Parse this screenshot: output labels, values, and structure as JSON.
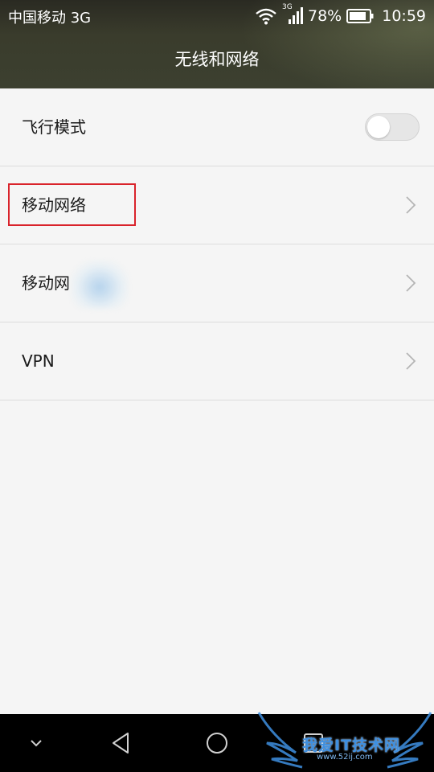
{
  "status_bar": {
    "carrier": "中国移动 3G",
    "network_badge": "3G",
    "battery_percent": "78%",
    "time": "10:59",
    "icons": [
      "wifi-icon",
      "cellular-signal-icon",
      "battery-icon"
    ]
  },
  "header": {
    "title": "无线和网络"
  },
  "settings": {
    "items": [
      {
        "label": "飞行模式",
        "control": "toggle",
        "toggle_on": false
      },
      {
        "label": "移动网络",
        "control": "chevron",
        "highlighted": true
      },
      {
        "label": "移动网",
        "control": "chevron",
        "partially_obscured": true
      },
      {
        "label": "VPN",
        "control": "chevron"
      }
    ]
  },
  "nav_bar": {
    "buttons": [
      "chevron-down-icon",
      "back-icon",
      "home-icon",
      "recents-icon"
    ]
  },
  "watermark": {
    "text": "我爱IT技术网",
    "url": "www.52ij.com"
  },
  "colors": {
    "highlight_box": "#d9232b",
    "background": "#f5f5f5",
    "divider": "#dcdcdc",
    "nav_bar": "#000000"
  }
}
